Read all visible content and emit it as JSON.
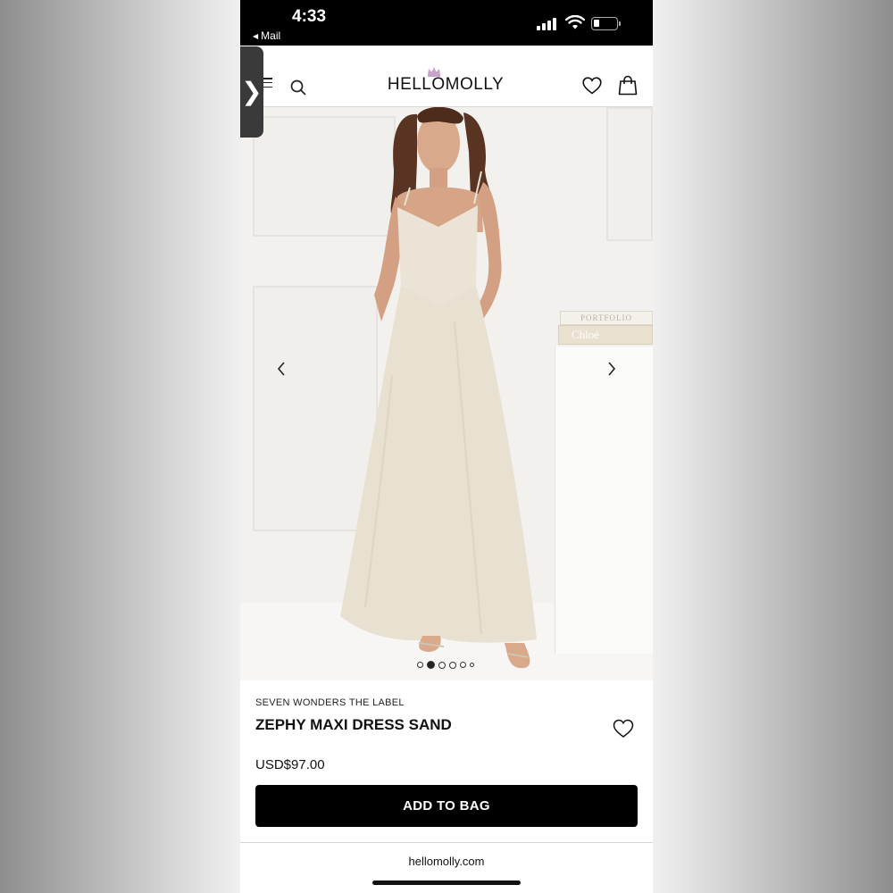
{
  "status_bar": {
    "time": "4:33",
    "back_label": "Mail",
    "battery_level": 0.25,
    "icons": [
      "signal-icon",
      "wifi-icon",
      "battery-icon"
    ]
  },
  "header": {
    "logo": "HELLOMOLLY",
    "icons": [
      "menu-icon",
      "search-icon",
      "heart-icon",
      "bag-icon"
    ],
    "accent_color": "#c8a3c9"
  },
  "gallery": {
    "image_description_icon": "product-photo",
    "current_slide": 2,
    "slide_count": 6,
    "book_labels": [
      "PORTFOLIO",
      "Chloé"
    ]
  },
  "product": {
    "brand": "SEVEN WONDERS THE LABEL",
    "title": "ZEPHY MAXI DRESS SAND",
    "price": "USD$97.00",
    "add_to_bag_label": "ADD TO BAG"
  },
  "browser": {
    "url": "hellomolly.com"
  },
  "colors": {
    "button_bg": "#000000",
    "button_text": "#ffffff",
    "dress": "#ebe4d6"
  }
}
